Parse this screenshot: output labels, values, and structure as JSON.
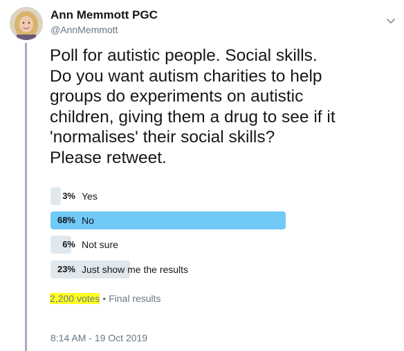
{
  "author": {
    "name": "Ann Memmott PGC",
    "handle": "@AnnMemmott"
  },
  "tweet": {
    "text": "Poll for autistic people. Social skills.\nDo you want autism charities to help\ngroups do experiments on autistic\nchildren, giving them a drug to see if it\n'normalises' their social skills?\nPlease retweet."
  },
  "poll": {
    "options": [
      {
        "percent": "3%",
        "label": "Yes",
        "value": 3
      },
      {
        "percent": "68%",
        "label": "No",
        "value": 68
      },
      {
        "percent": "6%",
        "label": "Not sure",
        "value": 6
      },
      {
        "percent": "23%",
        "label": "Just show me the results",
        "value": 23
      }
    ],
    "votes": "2,200 votes",
    "separator": "•",
    "status": "Final results"
  },
  "timestamp": "8:14 AM - 19 Oct 2019",
  "colors": {
    "winner_bar": "#71c9f8",
    "bar": "#e1e8ed",
    "thread_line": "#b7a3c7",
    "highlight": "#ffff22"
  }
}
